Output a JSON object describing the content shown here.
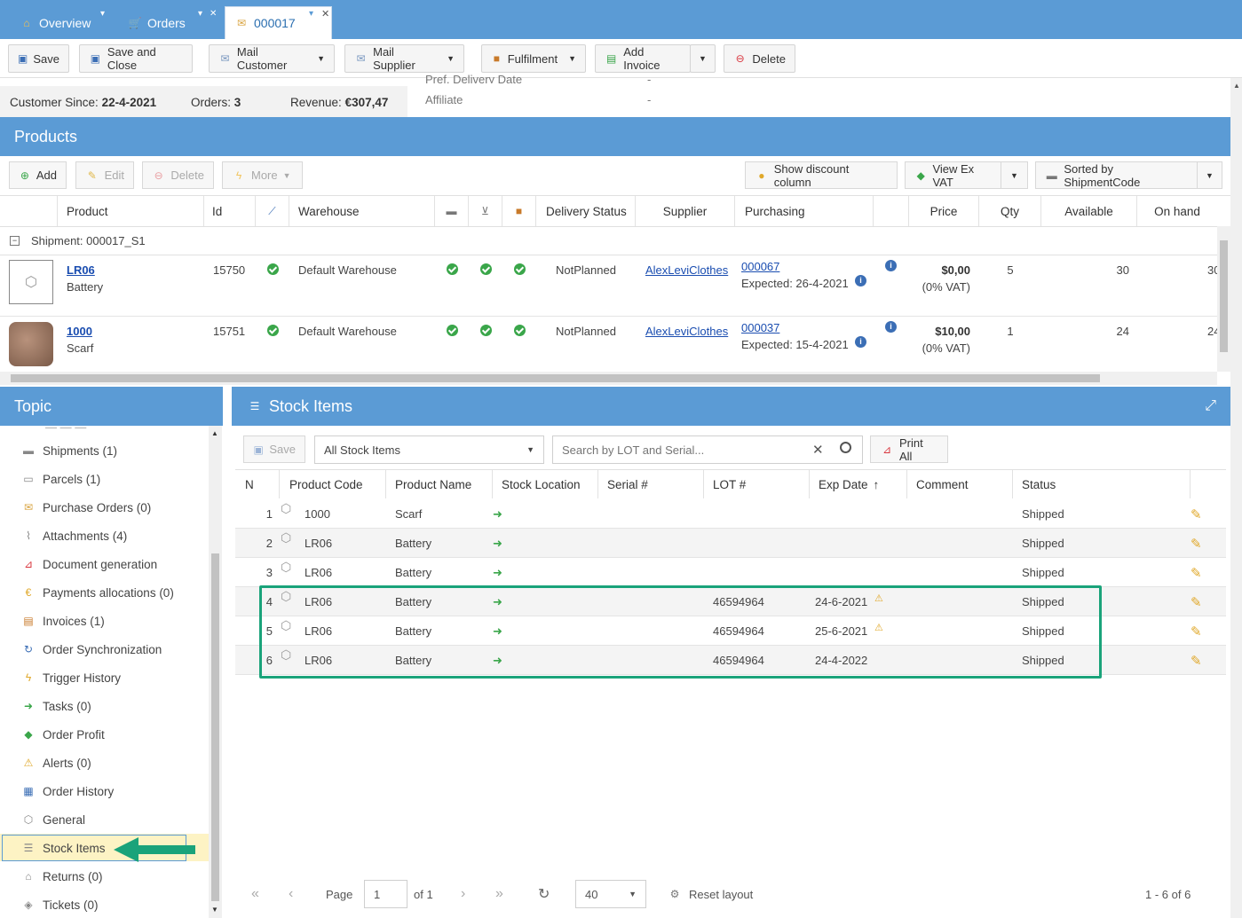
{
  "tabs": {
    "overview": "Overview",
    "orders": "Orders",
    "order": "000017"
  },
  "toolbar": {
    "save": "Save",
    "save_close": "Save and Close",
    "mail_customer": "Mail Customer",
    "mail_supplier": "Mail Supplier",
    "fulfilment": "Fulfilment",
    "add_invoice": "Add Invoice",
    "delete": "Delete"
  },
  "info": {
    "customer_since_label": "Customer Since:",
    "customer_since": "22-4-2021",
    "orders_label": "Orders:",
    "orders": "3",
    "revenue_label": "Revenue:",
    "revenue": "€307,47",
    "pref_delivery_label": "Pref. Delivery Date",
    "pref_delivery": "-",
    "affiliate_label": "Affiliate",
    "affiliate": "-"
  },
  "products": {
    "title": "Products",
    "add": "Add",
    "edit": "Edit",
    "delete": "Delete",
    "more": "More",
    "show_discount": "Show discount column",
    "view_ex_vat": "View Ex VAT",
    "sorted": "Sorted by ShipmentCode",
    "columns": {
      "product": "Product",
      "id": "Id",
      "warehouse": "Warehouse",
      "delivery_status": "Delivery Status",
      "supplier": "Supplier",
      "purchasing": "Purchasing",
      "price": "Price",
      "qty": "Qty",
      "available": "Available",
      "on_hand": "On hand"
    },
    "group": "Shipment: 000017_S1",
    "rows": [
      {
        "code": "LR06",
        "name": "Battery",
        "id": "15750",
        "warehouse": "Default Warehouse",
        "delivery": "NotPlanned",
        "supplier": "AlexLeviClothes",
        "po": "000067",
        "expected": "Expected: 26-4-2021",
        "price": "$0,00",
        "vat": "(0% VAT)",
        "qty": "5",
        "available": "30",
        "on_hand": "30"
      },
      {
        "code": "1000",
        "name": "Scarf",
        "id": "15751",
        "warehouse": "Default Warehouse",
        "delivery": "NotPlanned",
        "supplier": "AlexLeviClothes",
        "po": "000037",
        "expected": "Expected: 15-4-2021",
        "price": "$10,00",
        "vat": "(0% VAT)",
        "qty": "1",
        "available": "24",
        "on_hand": "24"
      }
    ]
  },
  "topic": {
    "title": "Topic",
    "items": [
      {
        "label": "Shipments (1)",
        "icon": "truck-icon"
      },
      {
        "label": "Parcels (1)",
        "icon": "parcel-icon"
      },
      {
        "label": "Purchase Orders (0)",
        "icon": "purchase-orders-icon"
      },
      {
        "label": "Attachments (4)",
        "icon": "paperclip-icon"
      },
      {
        "label": "Document generation",
        "icon": "pdf-icon"
      },
      {
        "label": "Payments allocations (0)",
        "icon": "euro-icon"
      },
      {
        "label": "Invoices (1)",
        "icon": "invoice-icon"
      },
      {
        "label": "Order Synchronization",
        "icon": "sync-icon"
      },
      {
        "label": "Trigger History",
        "icon": "lightning-icon"
      },
      {
        "label": "Tasks (0)",
        "icon": "arrow-right-icon"
      },
      {
        "label": "Order Profit",
        "icon": "money-icon"
      },
      {
        "label": "Alerts (0)",
        "icon": "alert-icon"
      },
      {
        "label": "Order History",
        "icon": "history-icon"
      },
      {
        "label": "General",
        "icon": "box-icon"
      },
      {
        "label": "Stock Items",
        "icon": "list-icon"
      },
      {
        "label": "Returns (0)",
        "icon": "returns-icon"
      },
      {
        "label": "Tickets (0)",
        "icon": "ticket-icon"
      }
    ]
  },
  "stock": {
    "title": "Stock Items",
    "save": "Save",
    "filter": "All Stock Items",
    "search_placeholder": "Search by LOT and Serial...",
    "print_all": "Print All",
    "columns": {
      "n": "N",
      "product_code": "Product Code",
      "product_name": "Product Name",
      "stock_location": "Stock Location",
      "serial": "Serial #",
      "lot": "LOT #",
      "exp_date": "Exp Date",
      "comment": "Comment",
      "status": "Status"
    },
    "rows": [
      {
        "n": "1",
        "code": "1000",
        "name": "Scarf",
        "lot": "",
        "exp": "",
        "warn": false,
        "status": "Shipped"
      },
      {
        "n": "2",
        "code": "LR06",
        "name": "Battery",
        "lot": "",
        "exp": "",
        "warn": false,
        "status": "Shipped"
      },
      {
        "n": "3",
        "code": "LR06",
        "name": "Battery",
        "lot": "",
        "exp": "",
        "warn": false,
        "status": "Shipped"
      },
      {
        "n": "4",
        "code": "LR06",
        "name": "Battery",
        "lot": "46594964",
        "exp": "24-6-2021",
        "warn": true,
        "status": "Shipped"
      },
      {
        "n": "5",
        "code": "LR06",
        "name": "Battery",
        "lot": "46594964",
        "exp": "25-6-2021",
        "warn": true,
        "status": "Shipped"
      },
      {
        "n": "6",
        "code": "LR06",
        "name": "Battery",
        "lot": "46594964",
        "exp": "24-4-2022",
        "warn": false,
        "status": "Shipped"
      }
    ],
    "pager": {
      "page_label": "Page",
      "page": "1",
      "of": "of 1",
      "page_size": "40",
      "reset": "Reset layout",
      "summary": "1 - 6 of 6"
    }
  },
  "colors": {
    "header_blue": "#5b9bd5",
    "highlight_green": "#1aa37a",
    "selected_yellow": "#fdf3c4"
  }
}
